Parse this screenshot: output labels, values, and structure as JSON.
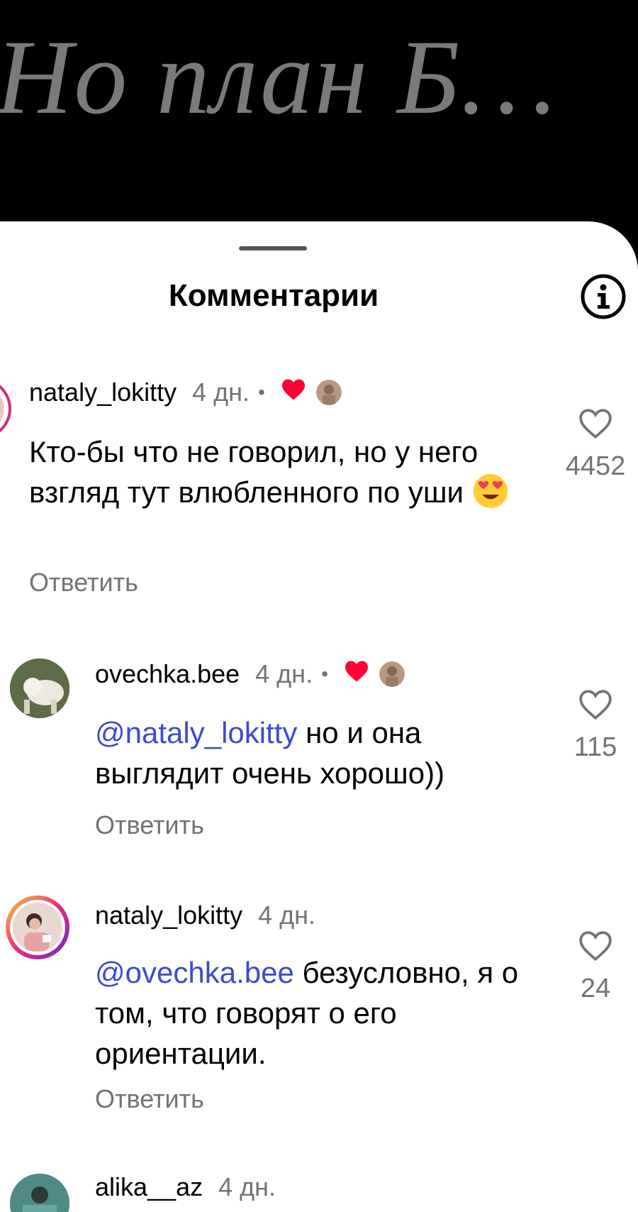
{
  "video": {
    "caption": "Но план Б…"
  },
  "sheet": {
    "title": "Комментарии",
    "info_icon": "info-icon"
  },
  "comments": [
    {
      "username": "nataly_lokitty",
      "time": "4 дн.",
      "dot": "•",
      "text": "Кто-бы что не говорил, но у него взгляд тут влюбленного по уши",
      "emoji": "😍",
      "reply": "Ответить",
      "likes": "4452"
    },
    {
      "username": "ovechka.bee",
      "time": "4 дн.",
      "dot": "•",
      "mention": "@nataly_lokitty",
      "text": " но и она выглядит очень хорошо))",
      "reply": "Ответить",
      "likes": "115"
    },
    {
      "username": "nataly_lokitty",
      "time": "4 дн.",
      "mention": "@ovechka.bee",
      "text": " безусловно, я о том, что говорят о его ориентации.",
      "reply": "Ответить",
      "likes": "24"
    },
    {
      "username": "alika__az",
      "time": "4 дн."
    }
  ],
  "colors": {
    "mention": "#3b4bd0",
    "muted": "#737373",
    "heart": "#ff0033",
    "story_ring": "#d62976"
  }
}
